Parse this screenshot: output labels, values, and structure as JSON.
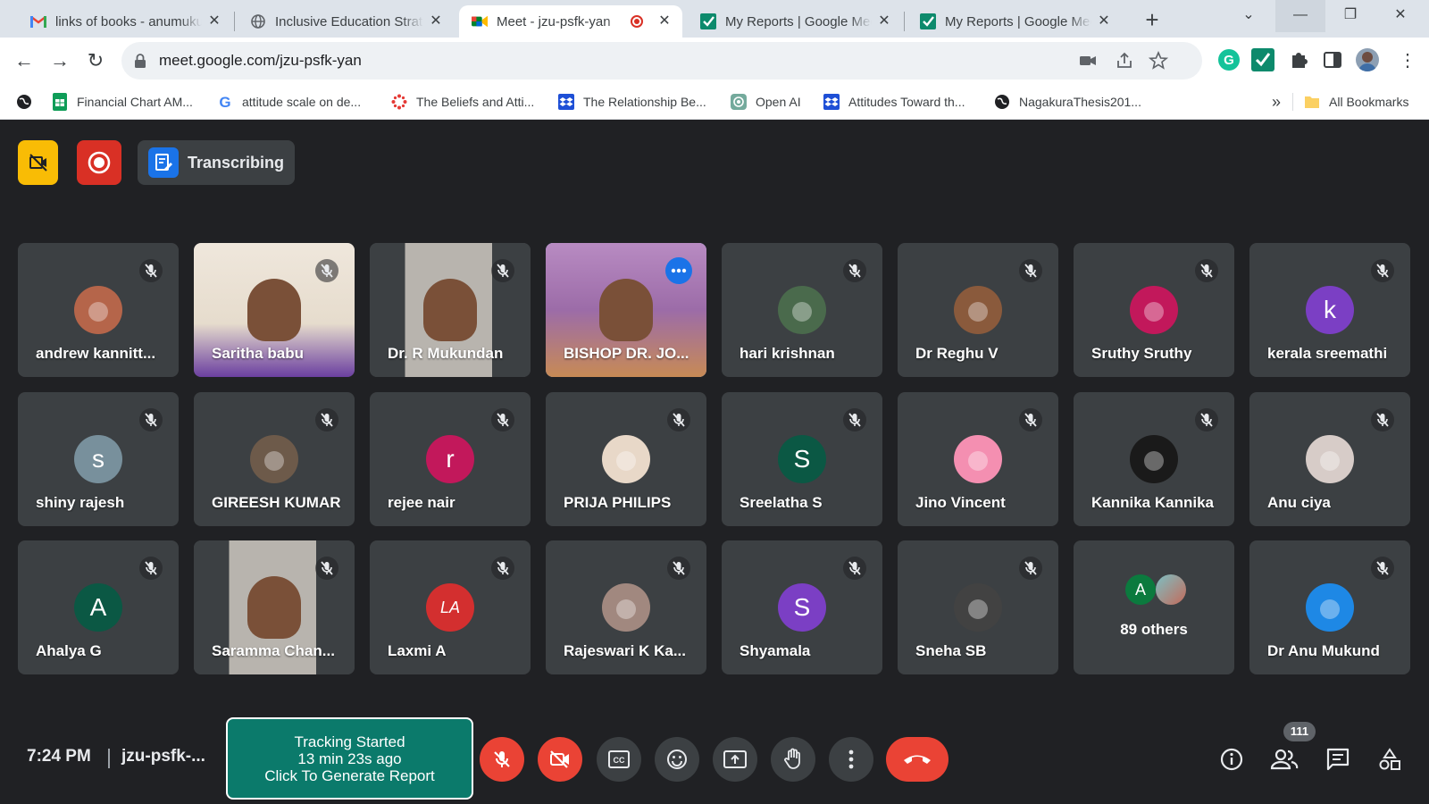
{
  "browser": {
    "tabs": [
      {
        "title": "links of books - anumukund",
        "icon": "gmail-icon"
      },
      {
        "title": "Inclusive Education Strategies",
        "icon": "globe-icon"
      },
      {
        "title": "Meet - jzu-psfk-yan",
        "icon": "meet-icon",
        "active": true
      },
      {
        "title": "My Reports | Google Meet",
        "icon": "check-icon"
      },
      {
        "title": "My Reports | Google Meet",
        "icon": "check-icon"
      }
    ],
    "url": "meet.google.com/jzu-psfk-yan",
    "bookmarks": [
      {
        "label": "",
        "icon": "globe-icon"
      },
      {
        "label": "Financial Chart AM...",
        "icon": "sheets-icon"
      },
      {
        "label": "attitude scale on de...",
        "icon": "google-icon"
      },
      {
        "label": "The Beliefs and Atti...",
        "icon": "puzzle-dots-icon"
      },
      {
        "label": "The Relationship Be...",
        "icon": "dropbox-icon"
      },
      {
        "label": "Open AI",
        "icon": "openai-icon"
      },
      {
        "label": "Attitudes Toward th...",
        "icon": "dropbox-icon"
      },
      {
        "label": "NagakuraThesis201...",
        "icon": "globe-icon"
      }
    ],
    "more_bookmarks": "»",
    "all_bookmarks": "All Bookmarks"
  },
  "meet": {
    "transcribing_label": "Transcribing",
    "participants": [
      {
        "name": "andrew kannitt...",
        "type": "photo",
        "color": "#b5654a"
      },
      {
        "name": "Saritha babu",
        "type": "video"
      },
      {
        "name": "Dr. R Mukundan",
        "type": "video"
      },
      {
        "name": "BISHOP DR. JO...",
        "type": "video",
        "speaking": true
      },
      {
        "name": "hari krishnan",
        "type": "photo",
        "color": "#4a6a4c"
      },
      {
        "name": "Dr Reghu V",
        "type": "photo",
        "color": "#8a5a3c"
      },
      {
        "name": "Sruthy Sruthy",
        "type": "photo",
        "color": "#c2185b"
      },
      {
        "name": "kerala sreemathi",
        "type": "letter",
        "letter": "k",
        "color": "#7b3fc4"
      },
      {
        "name": "shiny rajesh",
        "type": "letter",
        "letter": "s",
        "color": "#78909c"
      },
      {
        "name": "GIREESH KUMAR",
        "type": "photo",
        "color": "#6d5a4a"
      },
      {
        "name": "rejee nair",
        "type": "letter",
        "letter": "r",
        "color": "#c2185b"
      },
      {
        "name": "PRIJA PHILIPS",
        "type": "photo",
        "color": "#e8d8c8"
      },
      {
        "name": "Sreelatha S",
        "type": "letter",
        "letter": "S",
        "color": "#0b5844"
      },
      {
        "name": "Jino Vincent",
        "type": "photo",
        "color": "#f48fb1"
      },
      {
        "name": "Kannika Kannika",
        "type": "photo",
        "color": "#1a1a1a"
      },
      {
        "name": "Anu ciya",
        "type": "photo",
        "color": "#d7ccc8"
      },
      {
        "name": "Ahalya G",
        "type": "letter",
        "letter": "A",
        "color": "#0b5844"
      },
      {
        "name": "Saramma Chan...",
        "type": "video"
      },
      {
        "name": "Laxmi A",
        "type": "letter",
        "letter": "LA",
        "color": "#d32f2f"
      },
      {
        "name": "Rajeswari K Ka...",
        "type": "photo",
        "color": "#a1887f"
      },
      {
        "name": "Shyamala",
        "type": "letter",
        "letter": "S",
        "color": "#7b3fc4"
      },
      {
        "name": "Sneha SB",
        "type": "photo",
        "color": "#424242"
      },
      {
        "name": "89 others",
        "type": "others"
      },
      {
        "name": "Dr Anu Mukund",
        "type": "photo",
        "color": "#1e88e5"
      }
    ],
    "others_letter": "A",
    "clock": "7:24 PM",
    "meeting_code": "jzu-psfk-...",
    "tracking": {
      "line1": "Tracking Started",
      "line2": "13 min 23s ago",
      "line3": "Click To Generate Report"
    },
    "participant_count": "111"
  },
  "colors": {
    "background": "#202124",
    "tile": "#3c4043",
    "danger": "#ea4335",
    "tracking": "#0b7a6b",
    "accent": "#1a73e8"
  }
}
